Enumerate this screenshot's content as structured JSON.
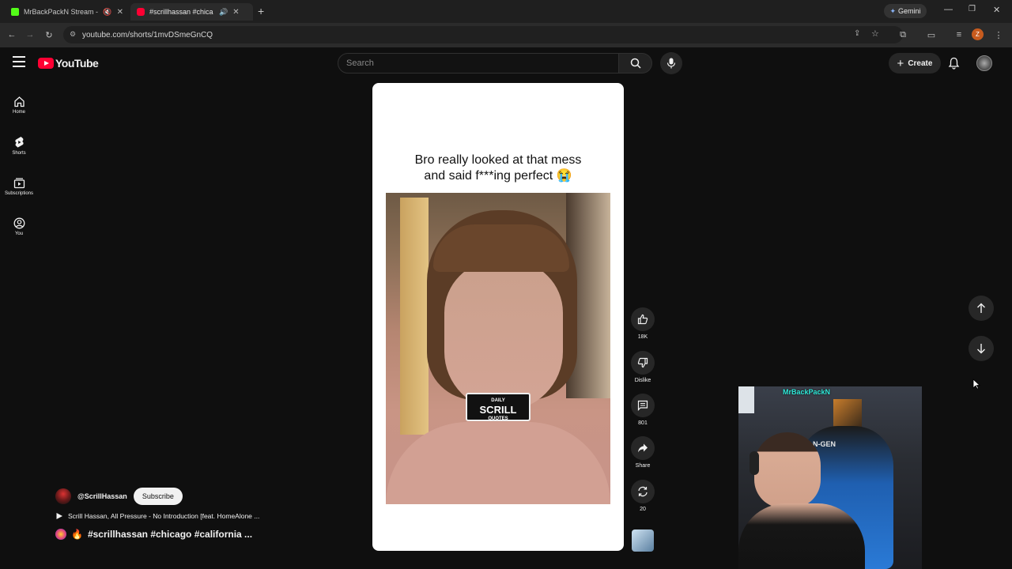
{
  "browser": {
    "tabs": [
      {
        "title": "MrBackPackN Stream - Wa",
        "favicon_color": "#53fc18",
        "active": false
      },
      {
        "title": "#scrillhassan #chica",
        "favicon_color": "#ff0033",
        "active": true
      }
    ],
    "new_tab_label": "+",
    "gemini_label": "Gemini",
    "url": "youtube.com/shorts/1mvDSmeGnCQ",
    "profile_initial": "Z"
  },
  "youtube": {
    "logo_text": "YouTube",
    "search_placeholder": "Search",
    "create_label": "Create",
    "nav": [
      {
        "label": "Home",
        "icon": "home-icon"
      },
      {
        "label": "Shorts",
        "icon": "shorts-icon"
      },
      {
        "label": "Subscriptions",
        "icon": "subscriptions-icon"
      },
      {
        "label": "You",
        "icon": "you-icon"
      }
    ]
  },
  "short": {
    "caption_line1": "Bro really looked at that mess",
    "caption_line2": "and said f***ing perfect 😭",
    "watermark_top": "DAILY",
    "watermark_mid": "SCRILL",
    "watermark_bot": "QUOTES",
    "actions": [
      {
        "name": "like",
        "label": "18K",
        "icon": "thumbs-up-icon"
      },
      {
        "name": "dislike",
        "label": "Dislike",
        "icon": "thumbs-down-icon"
      },
      {
        "name": "comments",
        "label": "801",
        "icon": "comment-icon"
      },
      {
        "name": "share",
        "label": "Share",
        "icon": "share-icon"
      },
      {
        "name": "remix",
        "label": "20",
        "icon": "remix-icon"
      }
    ],
    "channel": "@ScrillHassan",
    "subscribe_label": "Subscribe",
    "music": "Scrill Hassan, All Pressure - No Introduction [feat. HomeAlone ...",
    "hashtags": "#scrillhassan #chicago  #california ..."
  },
  "stream_overlay": {
    "streamer_name": "MrBackPackN",
    "chair_brand": "N-GEN"
  },
  "colors": {
    "youtube_red": "#ff0033",
    "background": "#0f0f0f",
    "kick_green": "#53fc18"
  }
}
